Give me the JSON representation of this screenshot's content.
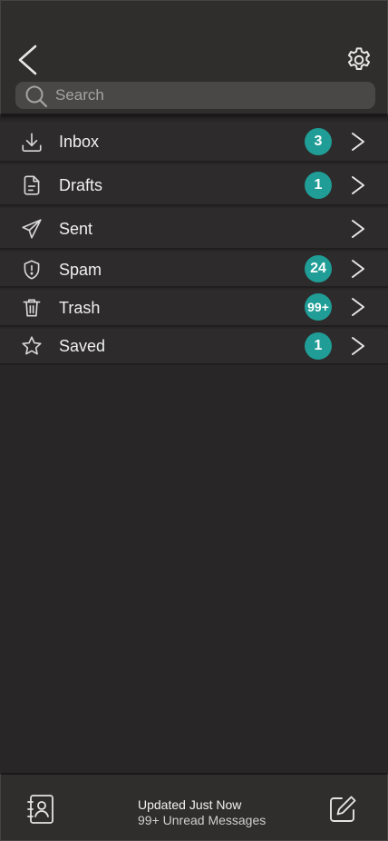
{
  "header": {
    "back_icon": "chevron-left-icon",
    "settings_icon": "gear-icon",
    "search": {
      "icon": "search-icon",
      "placeholder": "Search",
      "value": ""
    }
  },
  "folders": [
    {
      "label": "Inbox",
      "icon": "download-icon",
      "badge": "3"
    },
    {
      "label": "Drafts",
      "icon": "document-icon",
      "badge": "1"
    },
    {
      "label": "Sent",
      "icon": "send-icon",
      "badge": ""
    },
    {
      "label": "Spam",
      "icon": "shield-icon",
      "badge": "24"
    },
    {
      "label": "Trash",
      "icon": "trash-icon",
      "badge": "99+"
    },
    {
      "label": "Saved",
      "icon": "star-icon",
      "badge": "1"
    }
  ],
  "footer": {
    "status": "Updated Just Now",
    "unread": "99+ Unread Messages",
    "contacts_icon": "contacts-book-icon",
    "compose_icon": "compose-icon"
  },
  "colors": {
    "background": "#282626",
    "header": "#302e2c",
    "row": "#2d2b2b",
    "badge": "#1f9d96",
    "search_field": "#4a4847"
  }
}
